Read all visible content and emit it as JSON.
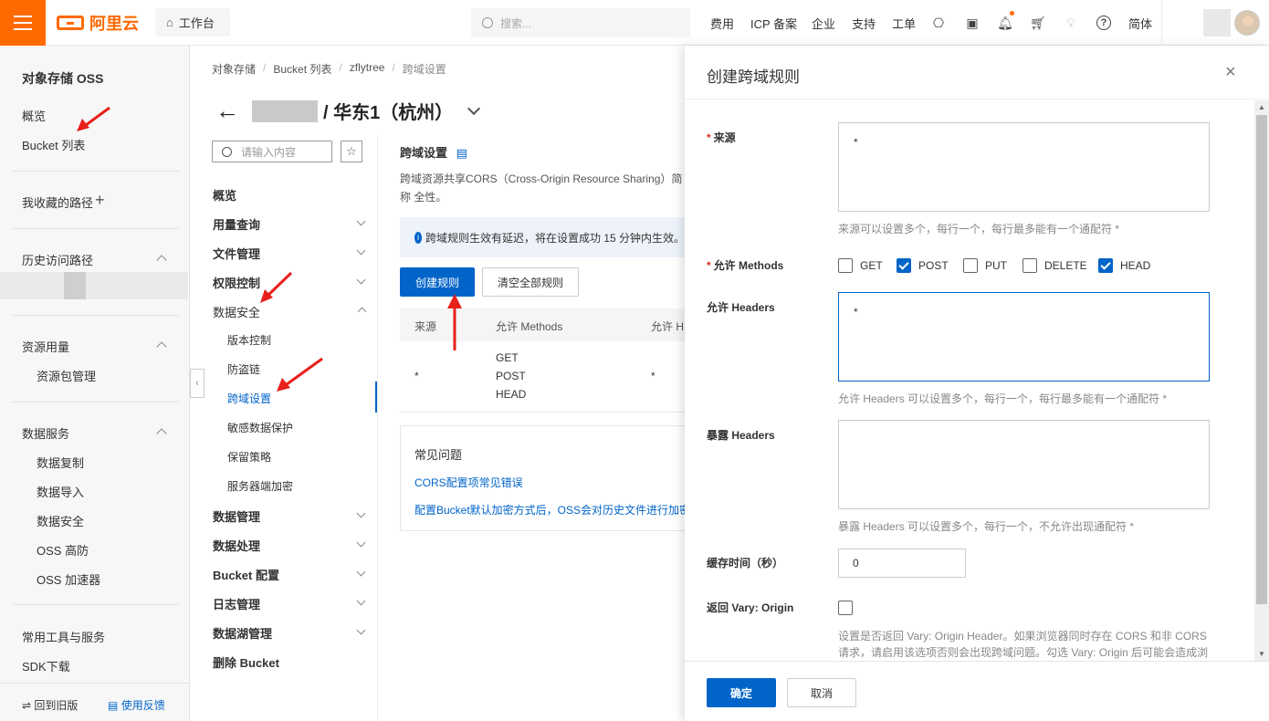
{
  "header": {
    "logo_text": "阿里云",
    "workbench": "工作台",
    "search_placeholder": "搜索...",
    "nav": [
      "费用",
      "ICP 备案",
      "企业",
      "支持",
      "工单"
    ],
    "lang": "简体"
  },
  "sidebar": {
    "title": "对象存储 OSS",
    "overview": "概览",
    "bucket_list": "Bucket 列表",
    "favorites": "我收藏的路径",
    "history": "历史访问路径",
    "resource_usage": "资源用量",
    "resource_pack": "资源包管理",
    "data_service": "数据服务",
    "data_service_items": [
      "数据复制",
      "数据导入",
      "数据安全",
      "OSS 高防",
      "OSS 加速器"
    ],
    "tools": "常用工具与服务",
    "sdk": "SDK下载",
    "back_old": "回到旧版",
    "feedback": "使用反馈"
  },
  "breadcrumb": [
    "对象存储",
    "Bucket 列表",
    "zflytree",
    "跨域设置"
  ],
  "bucket": {
    "region": "/ 华东1（杭州）"
  },
  "midnav": {
    "search_placeholder": "请输入内容",
    "items": {
      "overview": "概览",
      "usage": "用量查询",
      "files": "文件管理",
      "permission": "权限控制",
      "data_security": "数据安全",
      "version": "版本控制",
      "hotlink": "防盗链",
      "cors": "跨域设置",
      "sensitive": "敏感数据保护",
      "retention": "保留策略",
      "encryption": "服务器端加密",
      "data_mgmt": "数据管理",
      "data_proc": "数据处理",
      "bucket_cfg": "Bucket 配置",
      "log_mgmt": "日志管理",
      "lake_mgmt": "数据湖管理",
      "delete_bucket": "删除 Bucket"
    }
  },
  "content": {
    "title": "跨域设置",
    "desc": "跨域资源共享CORS（Cross-Origin Resource Sharing）简称 全性。",
    "notice": "跨域规则生效有延迟，将在设置成功 15 分钟内生效。",
    "btn_create": "创建规则",
    "btn_clear": "清空全部规则",
    "table": {
      "headers": [
        "来源",
        "允许 Methods",
        "允许 H"
      ],
      "row": {
        "origin": "*",
        "methods": [
          "GET",
          "POST",
          "HEAD"
        ],
        "headers": "*"
      }
    },
    "faq_title": "常见问题",
    "faq_links": [
      "CORS配置项常见错误",
      "配置Bucket默认加密方式后，OSS会对历史文件进行加密"
    ]
  },
  "drawer": {
    "title": "创建跨域规则",
    "close": "×",
    "origin_label": "来源",
    "origin_value": "*",
    "origin_help": "来源可以设置多个，每行一个，每行最多能有一个通配符 *",
    "methods_label": "允许 Methods",
    "methods": [
      {
        "name": "GET",
        "checked": false
      },
      {
        "name": "POST",
        "checked": true
      },
      {
        "name": "PUT",
        "checked": false
      },
      {
        "name": "DELETE",
        "checked": false
      },
      {
        "name": "HEAD",
        "checked": true
      }
    ],
    "headers_label": "允许 Headers",
    "headers_value": "*",
    "headers_help": "允许 Headers 可以设置多个，每行一个，每行最多能有一个通配符 *",
    "expose_label": "暴露 Headers",
    "expose_value": "",
    "expose_help": "暴露 Headers 可以设置多个，每行一个，不允许出现通配符 *",
    "cache_label": "缓存时间（秒）",
    "cache_value": "0",
    "vary_label": "返回 Vary: Origin",
    "vary_checked": false,
    "vary_help": "设置是否返回 Vary: Origin Header。如果浏览器同时存在 CORS 和非 CORS 请求，请启用该选项否则会出现跨域问题。勾选 Vary: Origin 后可能会造成浏览",
    "ok": "确定",
    "cancel": "取消"
  },
  "colors": {
    "brand": "#ff6a00",
    "primary": "#0064c8",
    "annotation_arrow": "#e8201a"
  }
}
